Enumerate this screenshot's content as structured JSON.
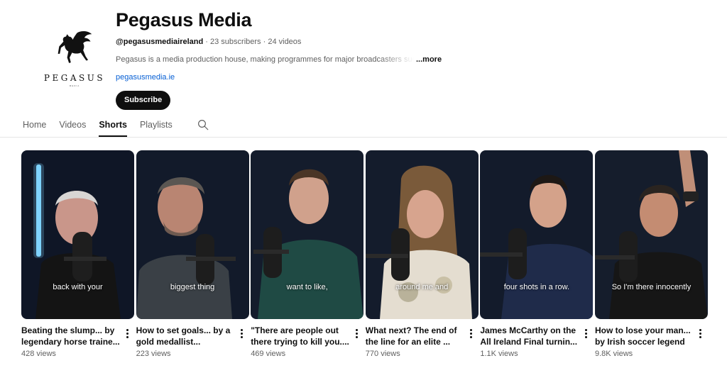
{
  "channel": {
    "logo_text": "PEGASUS",
    "logo_subtext": "MEDIA",
    "title": "Pegasus Media",
    "handle": "@pegasusmediaireland",
    "subscribers": "23 subscribers",
    "videos": "24 videos",
    "separator": " · ",
    "description": "Pegasus is a media production house, making programmes for major broadcasters such as",
    "more_label": "...more",
    "link": "pegasusmedia.ie",
    "subscribe_label": "Subscribe"
  },
  "tabs": [
    {
      "label": "Home",
      "active": false
    },
    {
      "label": "Videos",
      "active": false
    },
    {
      "label": "Shorts",
      "active": true
    },
    {
      "label": "Playlists",
      "active": false
    }
  ],
  "shorts": [
    {
      "title": "Beating the slump... by legendary horse traine...",
      "views": "428 views",
      "caption": "back with your"
    },
    {
      "title": "How to set goals... by a gold medallist...",
      "views": "223 views",
      "caption": "biggest thing"
    },
    {
      "title": "\"There are people out there trying to kill you....",
      "views": "469 views",
      "caption": "want to like,"
    },
    {
      "title": "What next? The end of the line for an elite ...",
      "views": "770 views",
      "caption": "around me and"
    },
    {
      "title": "James McCarthy on the All Ireland Final turnin...",
      "views": "1.1K views",
      "caption": "four shots in a row."
    },
    {
      "title": "How to lose your man... by Irish soccer legend ...",
      "views": "9.8K views",
      "caption": "So I'm there innocently"
    }
  ],
  "colors": {
    "subscribe_bg": "#0f0f0f",
    "link": "#065fd4",
    "muted_text": "#606060"
  }
}
